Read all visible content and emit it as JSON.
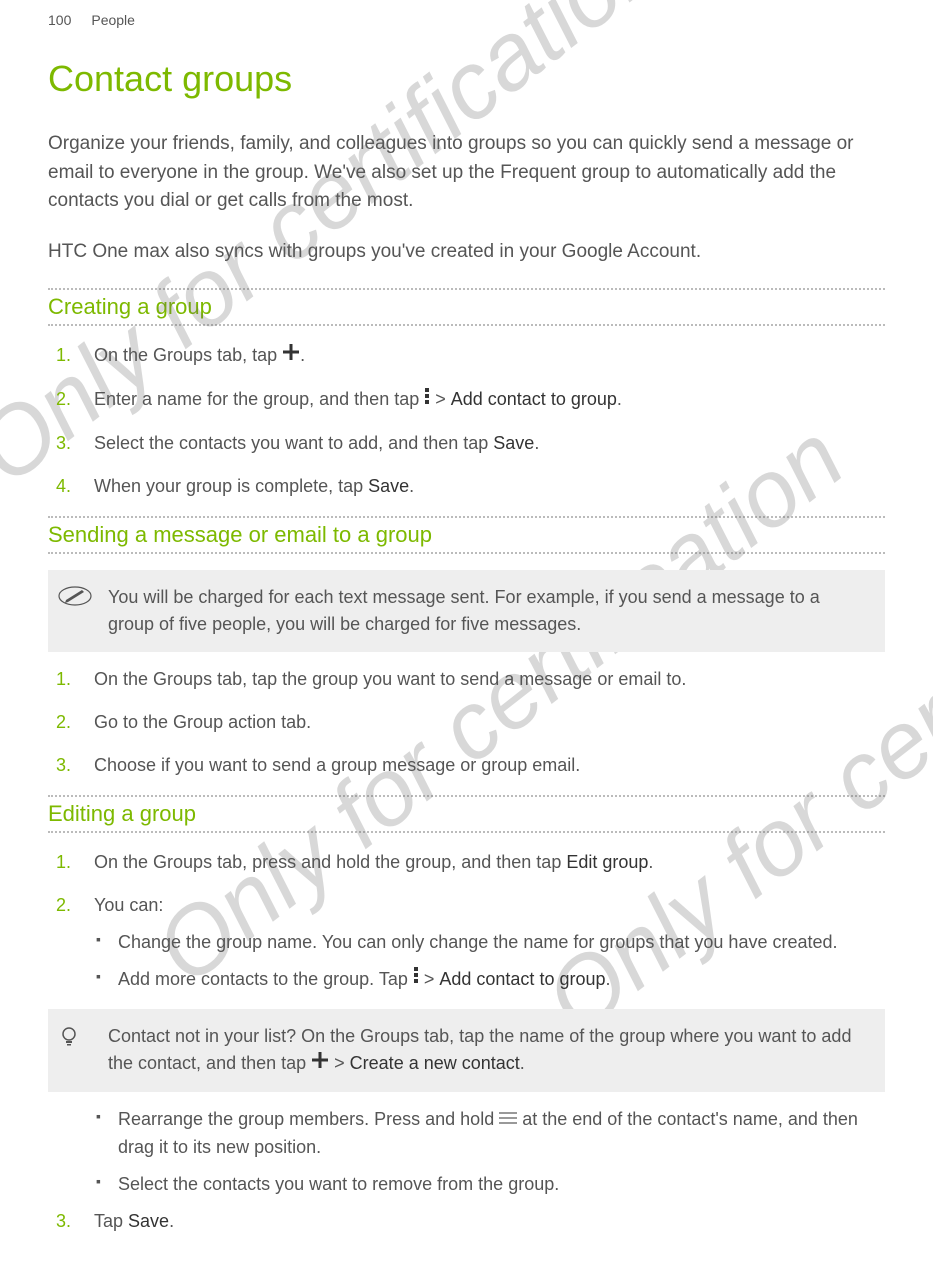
{
  "header": {
    "page_number": "100",
    "section": "People"
  },
  "title": "Contact groups",
  "intro": {
    "p1": "Organize your friends, family, and colleagues into groups so you can quickly send a message or email to everyone in the group. We've also set up the Frequent group to automatically add the contacts you dial or get calls from the most.",
    "p2": "HTC One max also syncs with groups you've created in your Google Account."
  },
  "creating": {
    "heading": "Creating a group",
    "s1a": "On the Groups tab, tap ",
    "s1b": ".",
    "s2a": "Enter a name for the group, and then tap ",
    "s2b": " > ",
    "s2c": "Add contact to group",
    "s2d": ".",
    "s3a": "Select the contacts you want to add, and then tap ",
    "s3b": "Save",
    "s3c": ".",
    "s4a": "When your group is complete, tap ",
    "s4b": "Save",
    "s4c": "."
  },
  "sending": {
    "heading": "Sending a message or email to a group",
    "tip": "You will be charged for each text message sent. For example, if you send a message to a group of five people, you will be charged for five messages.",
    "s1": "On the Groups tab, tap the group you want to send a message or email to.",
    "s2": "Go to the Group action tab.",
    "s3": "Choose if you want to send a group message or group email."
  },
  "editing": {
    "heading": "Editing a group",
    "s1a": "On the Groups tab, press and hold the group, and then tap ",
    "s1b": "Edit group",
    "s1c": ".",
    "s2": "You can:",
    "b1": "Change the group name. You can only change the name for groups that you have created.",
    "b2a": "Add more contacts to the group. Tap ",
    "b2b": " > ",
    "b2c": "Add contact to group",
    "b2d": ".",
    "info_a": "Contact not in your list? On the Groups tab, tap the name of the group where you want to add the contact, and then tap ",
    "info_b": " > ",
    "info_c": "Create a new contact",
    "info_d": ".",
    "b3a": "Rearrange the group members. Press and hold ",
    "b3b": " at the end of the contact's name, and then drag it to its new position.",
    "b4": "Select the contacts you want to remove from the group.",
    "s3a": "Tap ",
    "s3b": "Save",
    "s3c": "."
  },
  "watermark": "Only for certification"
}
